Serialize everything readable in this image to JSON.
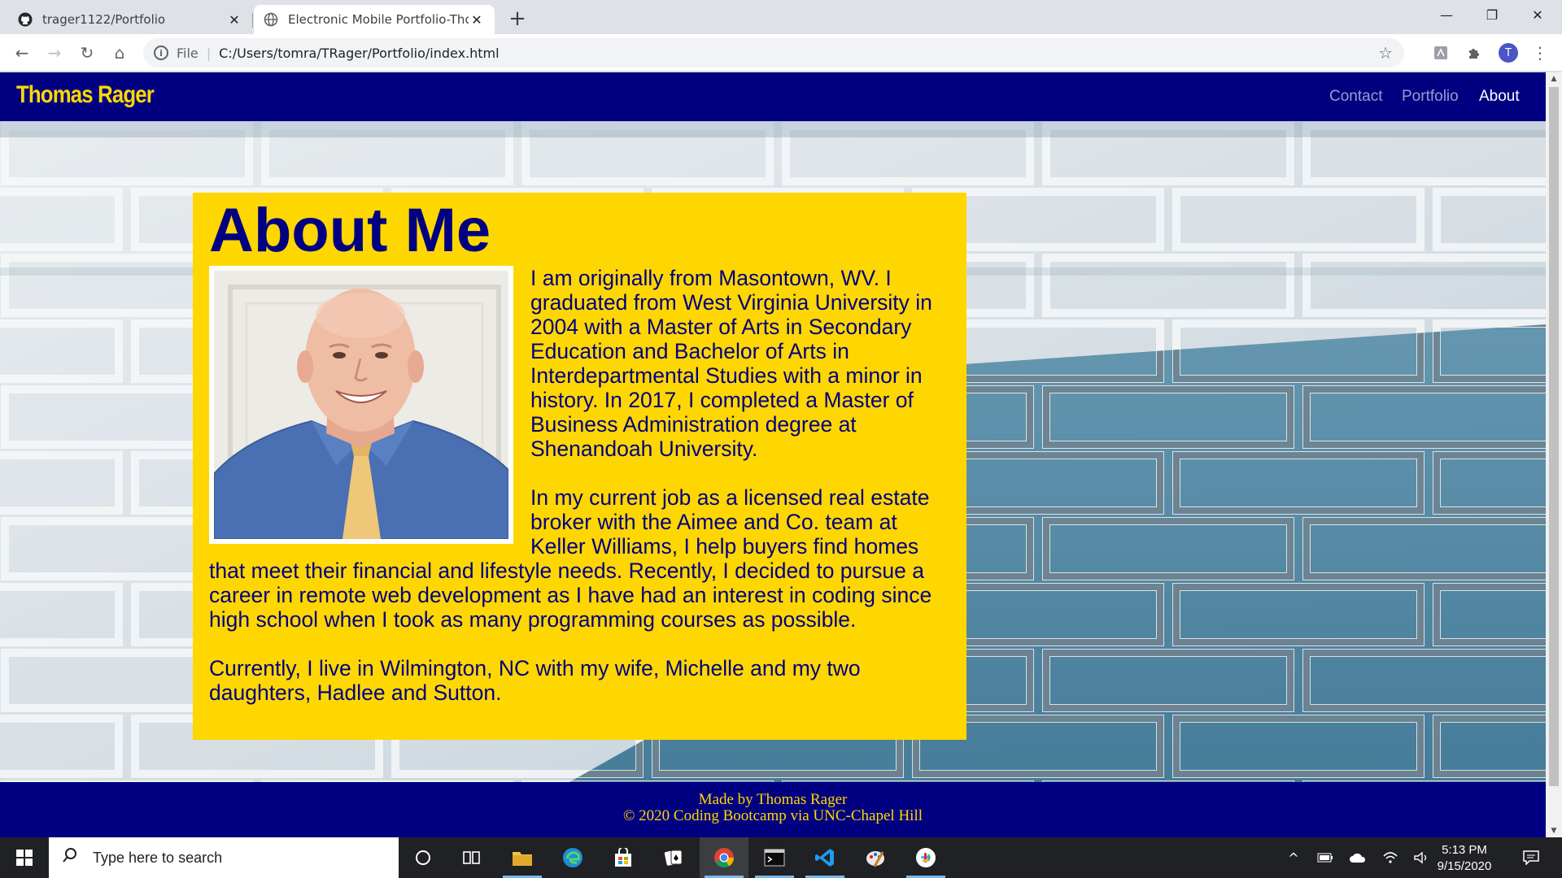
{
  "browser": {
    "tabs": [
      {
        "title": "trager1122/Portfolio",
        "icon": "github-icon",
        "active": false
      },
      {
        "title": "Electronic Mobile Portfolio-Thom",
        "icon": "globe-icon",
        "active": true
      }
    ],
    "address": {
      "scheme": "File",
      "url": "C:/Users/tomra/TRager/Portfolio/index.html"
    },
    "profile_initial": "T"
  },
  "site": {
    "brand": "Thomas Rager",
    "nav": [
      {
        "label": "Contact",
        "active": false
      },
      {
        "label": "Portfolio",
        "active": false
      },
      {
        "label": "About",
        "active": true
      }
    ],
    "about": {
      "title": "About Me",
      "paragraphs": [
        "I am originally from Masontown, WV. I graduated from West Virginia University in 2004 with a Master of Arts in Secondary Education and Bachelor of Arts in Interdepartmental Studies with a minor in history. In 2017, I completed a Master of Business Administration degree at Shenandoah University.",
        "In my current job as a licensed real estate broker with the Aimee and Co. team at Keller Williams, I help buyers find homes that meet their financial and lifestyle needs. Recently, I decided to pursue a career in remote web development as I have had an interest in coding since high school when I took as many programming courses as possible.",
        "Currently, I live in Wilmington, NC with my wife, Michelle and my two daughters, Hadlee and Sutton."
      ]
    },
    "footer": {
      "line1": "Made by Thomas Rager",
      "line2": "© 2020 Coding Bootcamp via UNC-Chapel Hill"
    },
    "colors": {
      "navy": "#000080",
      "gold": "#ffd700"
    }
  },
  "taskbar": {
    "search_placeholder": "Type here to search",
    "time": "5:13 PM",
    "date": "9/15/2020"
  }
}
